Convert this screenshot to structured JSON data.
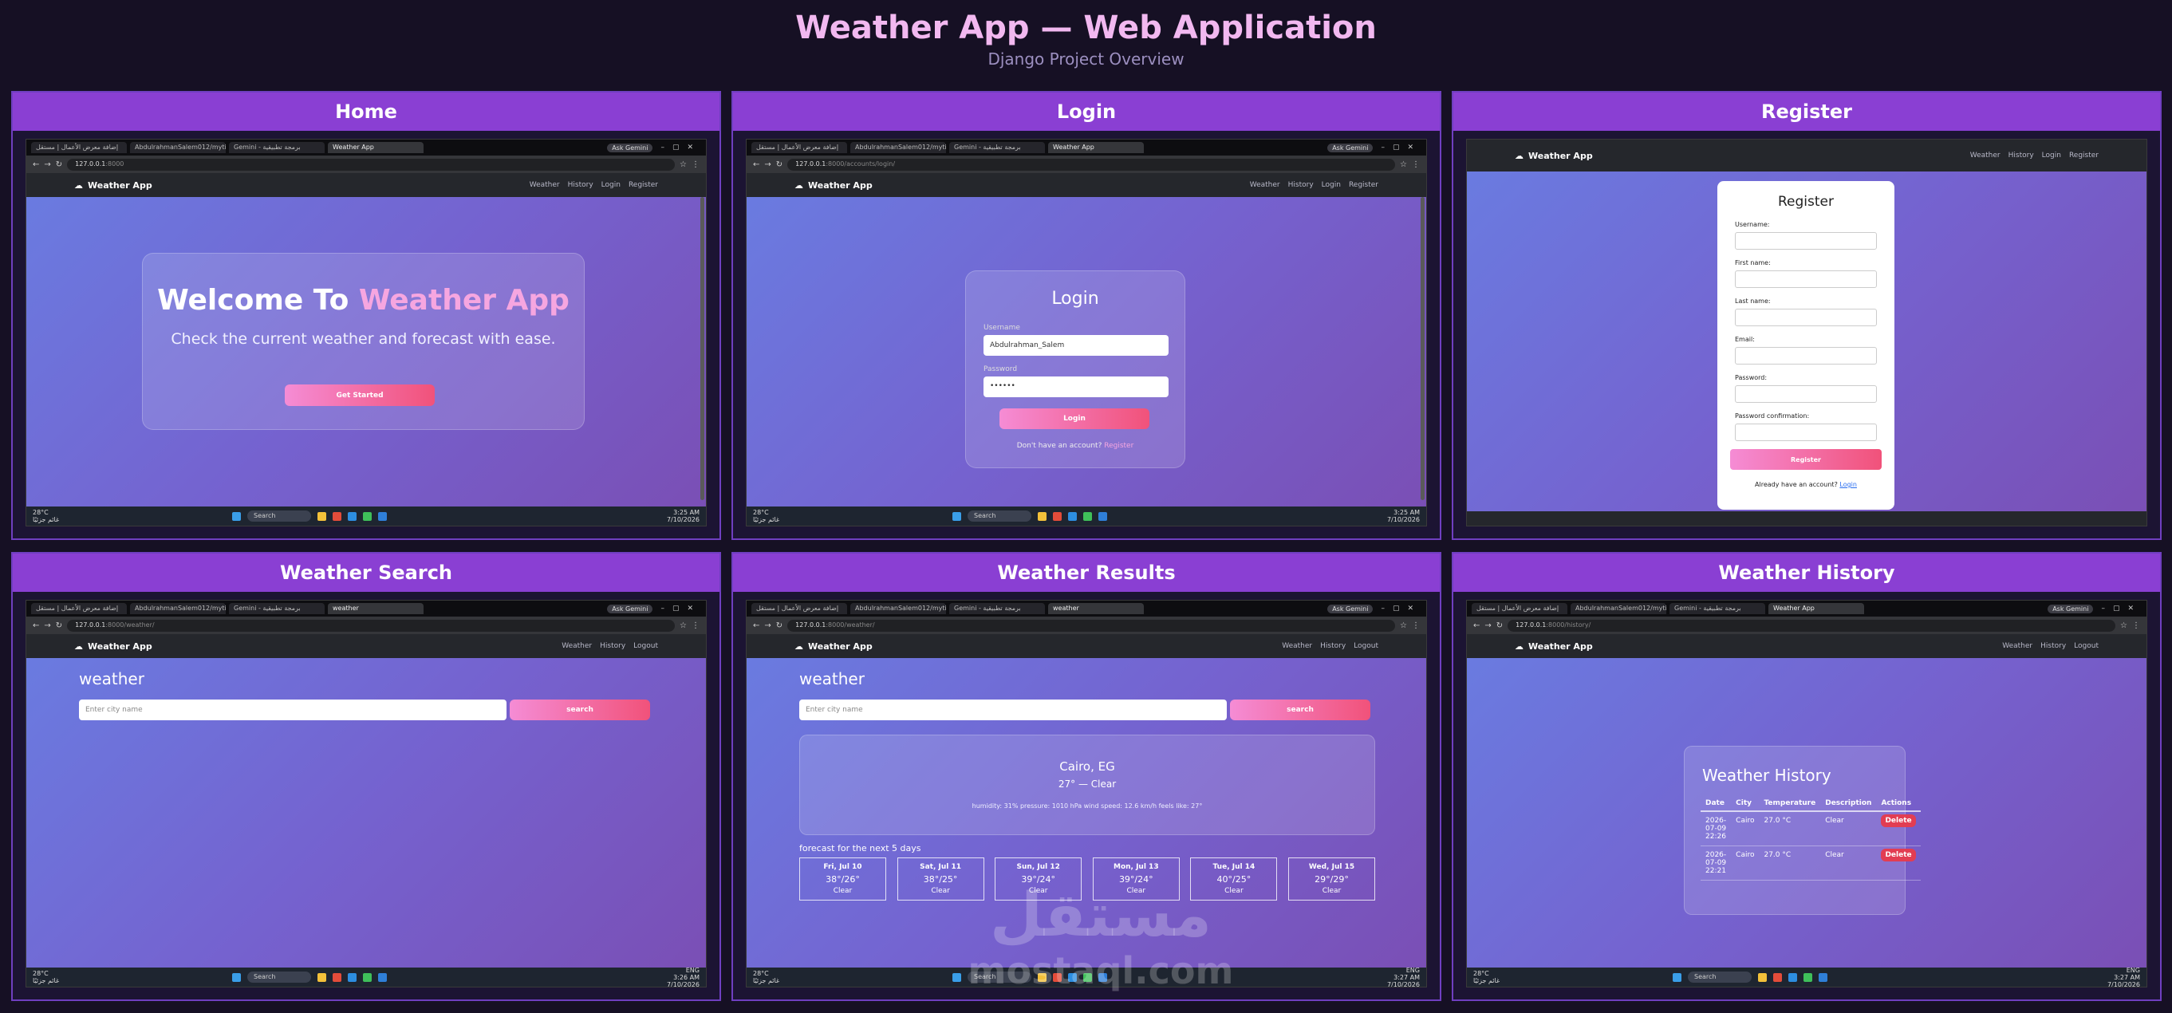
{
  "header": {
    "title": "Weather App — Web Application",
    "subtitle": "Django Project Overview"
  },
  "common": {
    "brand": "Weather App",
    "ask_gemini": "Ask Gemini",
    "tab_weather": "Weather App",
    "tab_github": "AbdulrahmanSalem012/mytim...",
    "tab_gemini": "Gemini - برمجة تطبيقية",
    "tab_mostaql": "إضافة معرض الأعمال | مستقل",
    "nav_weather": "Weather",
    "nav_history": "History",
    "nav_login": "Login",
    "nav_register": "Register",
    "nav_logout": "Logout",
    "tb_temp": "28°C",
    "tb_cond": "غائم جزئيًا",
    "tb_search": "Search",
    "tb_lang": "ENG",
    "tb_date": "7/10/2026"
  },
  "panels": {
    "home": {
      "title": "Home",
      "url_host": "127.0.0.1",
      "url_rest": ":8000",
      "time": "3:25 AM",
      "welcome_a": "Welcome To ",
      "welcome_b": "Weather App",
      "tagline": "Check the current weather and forecast with ease.",
      "cta": "Get Started"
    },
    "login": {
      "title": "Login",
      "url_host": "127.0.0.1",
      "url_rest": ":8000/accounts/login/",
      "time": "3:25 AM",
      "heading": "Login",
      "username_label": "Username",
      "username_value": "Abdulrahman_Salem",
      "password_label": "Password",
      "password_value": "••••••",
      "button": "Login",
      "no_account": "Don't have an account?",
      "register_link": "Register"
    },
    "register": {
      "title": "Register",
      "heading": "Register",
      "labels": [
        "Username:",
        "First name:",
        "Last name:",
        "Email:",
        "Password:",
        "Password confirmation:"
      ],
      "button": "Register",
      "have_account": "Already have an account?",
      "login_link": "Login"
    },
    "search": {
      "title": "Weather Search",
      "url_host": "127.0.0.1",
      "url_rest": ":8000/weather/",
      "time": "3:26 AM",
      "tab": "weather",
      "heading": "weather",
      "placeholder": "Enter city name",
      "button": "search"
    },
    "results": {
      "title": "Weather Results",
      "url_host": "127.0.0.1",
      "url_rest": ":8000/weather/",
      "time": "3:27 AM",
      "tab": "weather",
      "heading": "weather",
      "placeholder": "Enter city name",
      "button": "search",
      "city": "Cairo, EG",
      "current": "27° — Clear",
      "details": "humidity: 31%   pressure: 1010 hPa   wind speed: 12.6 km/h   feels like: 27°",
      "forecast_title": "forecast for the next 5 days",
      "forecast": [
        {
          "day": "Fri, Jul 10",
          "temps": "38°/26°",
          "desc": "Clear"
        },
        {
          "day": "Sat, Jul 11",
          "temps": "38°/25°",
          "desc": "Clear"
        },
        {
          "day": "Sun, Jul 12",
          "temps": "39°/24°",
          "desc": "Clear"
        },
        {
          "day": "Mon, Jul 13",
          "temps": "39°/24°",
          "desc": "Clear"
        },
        {
          "day": "Tue, Jul 14",
          "temps": "40°/25°",
          "desc": "Clear"
        },
        {
          "day": "Wed, Jul 15",
          "temps": "29°/29°",
          "desc": "Clear"
        }
      ]
    },
    "history": {
      "title": "Weather History",
      "url_host": "127.0.0.1",
      "url_rest": ":8000/history/",
      "time": "3:27 AM",
      "heading": "Weather History",
      "columns": [
        "Date",
        "City",
        "Temperature",
        "Description",
        "Actions"
      ],
      "rows": [
        {
          "date": "2026-07-09 22:26",
          "city": "Cairo",
          "temp": "27.0 °C",
          "desc": "Clear",
          "action": "Delete"
        },
        {
          "date": "2026-07-09 22:21",
          "city": "Cairo",
          "temp": "27.0 °C",
          "desc": "Clear",
          "action": "Delete"
        }
      ]
    }
  },
  "watermark": {
    "arabic": "مستقل",
    "latin": "mostaql.com"
  }
}
